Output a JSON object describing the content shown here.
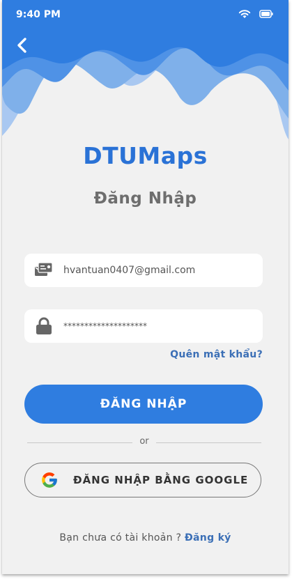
{
  "status_bar": {
    "time": "9:40 PM",
    "icons": [
      "wifi-icon",
      "battery-icon"
    ]
  },
  "header": {
    "back_icon": "chevron-left-icon"
  },
  "app": {
    "logo": "DTUMaps",
    "title": "Đăng Nhập"
  },
  "form": {
    "email": {
      "value": "hvantuan0407@gmail.com",
      "icon": "email-card-icon"
    },
    "password": {
      "value": "********************",
      "icon": "lock-icon"
    },
    "forgot_label": "Quên mật khẩu?",
    "login_label": "ĐĂNG NHẬP"
  },
  "divider": {
    "label": "or"
  },
  "google": {
    "label": "ĐĂNG NHẬP BẰNG GOOGLE",
    "icon": "google-icon"
  },
  "signup": {
    "prompt": "Bạn chưa có tài khoản ? ",
    "link": "Đăng ký"
  },
  "colors": {
    "primary": "#2f7de0",
    "link": "#3b6fb6",
    "background": "#f1f1f1",
    "wave_light": "#a7c7f0"
  }
}
